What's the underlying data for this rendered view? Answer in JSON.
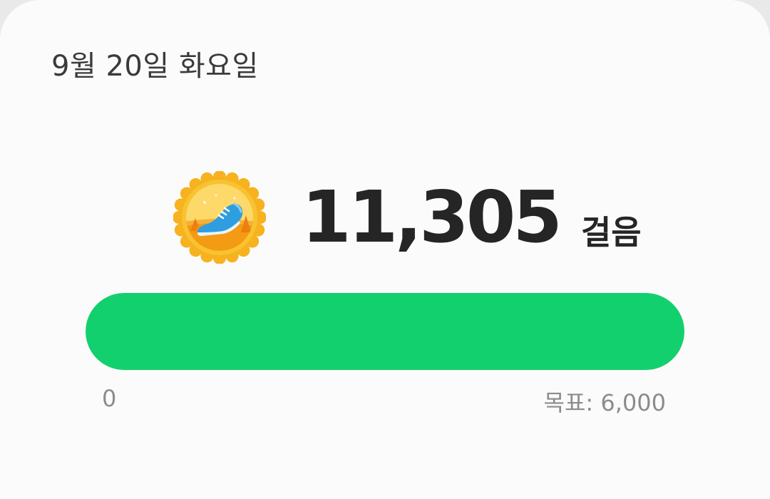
{
  "date": "9월 20일 화요일",
  "steps": {
    "count": "11,305",
    "unit": "걸음",
    "medal_icon": "running-shoe-medal-icon"
  },
  "progress": {
    "value": 11305,
    "goal": 6000,
    "fraction": 1.0,
    "min_label": "0",
    "goal_label": "목표: 6,000"
  },
  "colors": {
    "progress_fill": "#13d06e",
    "medal_gold": "#f7b21f",
    "shoe_blue": "#2f9ee0"
  }
}
